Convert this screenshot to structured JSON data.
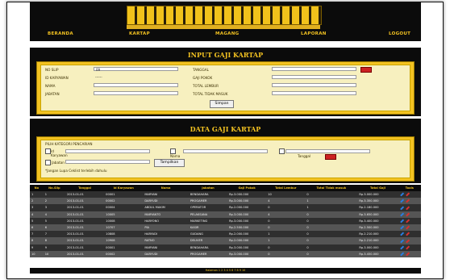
{
  "nav": {
    "items": [
      "BERANDA",
      "KARTAP",
      "MAGANG",
      "LAPORAN",
      "LOGOUT"
    ]
  },
  "input_form": {
    "title": "INPUT GAJI KARTAP",
    "fields_left": [
      {
        "label": "NO SLIP",
        "value": "09"
      },
      {
        "label": "ID KARYAWAN",
        "value": "------"
      },
      {
        "label": "NAMA",
        "value": ""
      },
      {
        "label": "JABATAN",
        "value": ""
      }
    ],
    "fields_right": [
      {
        "label": "TANGGAL",
        "value": ""
      },
      {
        "label": "GAJI POKOK",
        "value": ""
      },
      {
        "label": "TOTAL LEMBUR",
        "value": ""
      },
      {
        "label": "TOTAL TIDAK MASUK",
        "value": ""
      }
    ],
    "save_label": "Simpan"
  },
  "data_panel": {
    "title": "DATA GAJI KARTAP",
    "filter_heading": "PILIH KATEGORI PENCARIAN",
    "filter_karyawan": "Id Karyawan",
    "filter_nama": "Nama",
    "filter_tanggal": "Tanggal",
    "filter_jabatan": "Jabatan",
    "show_label": "Tampilkan",
    "note": "*Jangan Lupa Ceklist terlebih dahulu"
  },
  "table": {
    "headers": [
      "No",
      "No.Slip",
      "Tanggal",
      "Id Karyawan",
      "Nama",
      "Jabatan",
      "Gaji Pokok",
      "Total Lembur",
      "Total Tidak masuk",
      "Total Gaji",
      "Tools"
    ],
    "rows": [
      [
        "1",
        "1",
        "2013-01-01",
        "00001",
        "MARYANI",
        "BENDAHARA",
        "Rp.3.000.000",
        "10",
        "0",
        "Rp.3.000.000"
      ],
      [
        "2",
        "2",
        "2013-01-01",
        "00002",
        "DARYUDI",
        "PROGAMER",
        "Rp.3.000.000",
        "4",
        "1",
        "Rp.3.350.000"
      ],
      [
        "3",
        "3",
        "2013-01-01",
        "00004",
        "ABDUL MAKIM",
        "OPERATOR",
        "Rp.2.000.000",
        "0",
        "1",
        "Rp.2.180.000"
      ],
      [
        "4",
        "4",
        "2013-01-01",
        "10005",
        "MARYANTO",
        "PELAKSANA",
        "Rp.3.000.000",
        "4",
        "0",
        "Rp.3.650.000"
      ],
      [
        "5",
        "5",
        "2013-01-01",
        "10008",
        "HARYONO",
        "MARKETING",
        "Rp.3.000.000",
        "0",
        "0",
        "Rp.3.400.000"
      ],
      [
        "6",
        "6",
        "2013-01-01",
        "10707",
        "PIA",
        "KASIR",
        "Rp.2.500.000",
        "0",
        "0",
        "Rp.2.500.000"
      ],
      [
        "7",
        "7",
        "2013-01-01",
        "10808",
        "HARYADI",
        "GUDANG",
        "Rp.2.000.000",
        "1",
        "0",
        "Rp.2.210.000"
      ],
      [
        "8",
        "8",
        "2013-01-01",
        "10908",
        "RATNO",
        "DELIVER",
        "Rp.2.000.000",
        "1",
        "0",
        "Rp.2.210.000"
      ],
      [
        "9",
        "9",
        "2013-01-01",
        "00001",
        "MARYANI",
        "BENDAHARA",
        "Rp.3.000.000",
        "0",
        "0",
        "Rp.3.000.000"
      ],
      [
        "10",
        "10",
        "2013-01-01",
        "00002",
        "DARYUDI",
        "PROGAMER",
        "Rp.3.000.000",
        "0",
        "0",
        "Rp.3.450.000"
      ]
    ]
  },
  "pager": "Halaman 1 2 3 4 5 6 7 8 9 10"
}
